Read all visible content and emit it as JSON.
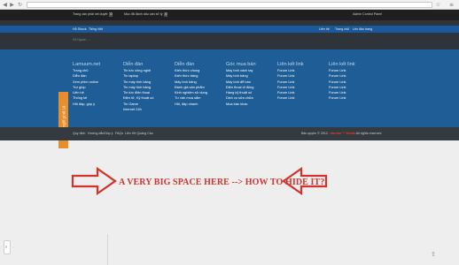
{
  "browser": {
    "back_glyph": "◀",
    "forward_glyph": "▶",
    "reload_glyph": "↻",
    "address": "",
    "star_glyph": "☆",
    "menu_glyph": "≡"
  },
  "topbar": {
    "left_item": "Trang cần phải xét duyệt",
    "left_count": "0",
    "mid_item": "Mục đã đánh dấu cần xử lý",
    "mid_count": "0",
    "right_item": "Admin Control Panel"
  },
  "header": {
    "home": "Hỗ Shock",
    "lang": "Tiếng Việt",
    "right_links": [
      "Liên hệ",
      "Trang chủ",
      "Lên đầu trang"
    ],
    "breadcrumb": "Hỗ Nguồn - ...",
    "accent": "#1a5a9c"
  },
  "footer_columns": [
    {
      "title": "Lamuum.net",
      "items": [
        "Trang chủ",
        "Diễn đàn",
        "Xem phim online",
        "Trợ giúp",
        "Liên hệ",
        "Thống kê",
        "Hỏi đáp, góp ý"
      ]
    },
    {
      "title": "Diễn đàn",
      "items": [
        "Tin tức công nghệ",
        "Tin laptop",
        "Tin máy tính bảng",
        "Tin máy tính bảng",
        "Tin tức điện thoại",
        "Điện tử, Kỹ thuật số",
        "Tin Game",
        "Internet 24h"
      ]
    },
    {
      "title": "Diễn đàn",
      "items": [
        "Kiến thức chung",
        "Kiến thức bảng",
        "Máy tính bảng",
        "Đánh giá sản phẩm",
        "Kinh nghiệm sử dụng",
        "Tư vấn mua sắm",
        "Hỏi, đáp nhanh"
      ]
    },
    {
      "title": "Góc mua bán",
      "items": [
        "Máy tính xách tay",
        "Máy tính bảng",
        "Máy tính để bàn",
        "Điện thoại di động",
        "Hàng kỹ thuật số",
        "Dịch vụ sửa chữa",
        "Mua bán khác"
      ]
    },
    {
      "title": "Liên kết link",
      "items": [
        "Forum Link",
        "Forum Link",
        "Forum Link",
        "Forum Link",
        "Forum Link",
        "Forum Link"
      ]
    },
    {
      "title": "Liên kết link",
      "items": [
        "Forum Link",
        "Forum Link",
        "Forum Link",
        "Forum Link",
        "Forum Link",
        "Forum Link"
      ]
    }
  ],
  "side_tab": {
    "label": "Bạn nghĩ gì về Lê"
  },
  "bottom_bar": {
    "links": [
      "Quy định",
      "Hướng dẫn",
      "Giúp ý",
      "FAQs",
      "Liên Hệ Quảng Cáo"
    ],
    "copyright": "Bản quyền © 2012 -",
    "brand": "Mortan ™ Media",
    "rights": "All rights reserved"
  },
  "annotation": {
    "text": "A VERY BIG SPACE HERE --> HOW TO HIDE IT?",
    "color": "#d0342c"
  },
  "corner_widget": {
    "label": "≡"
  },
  "scroll_top_glyph": "⇧"
}
